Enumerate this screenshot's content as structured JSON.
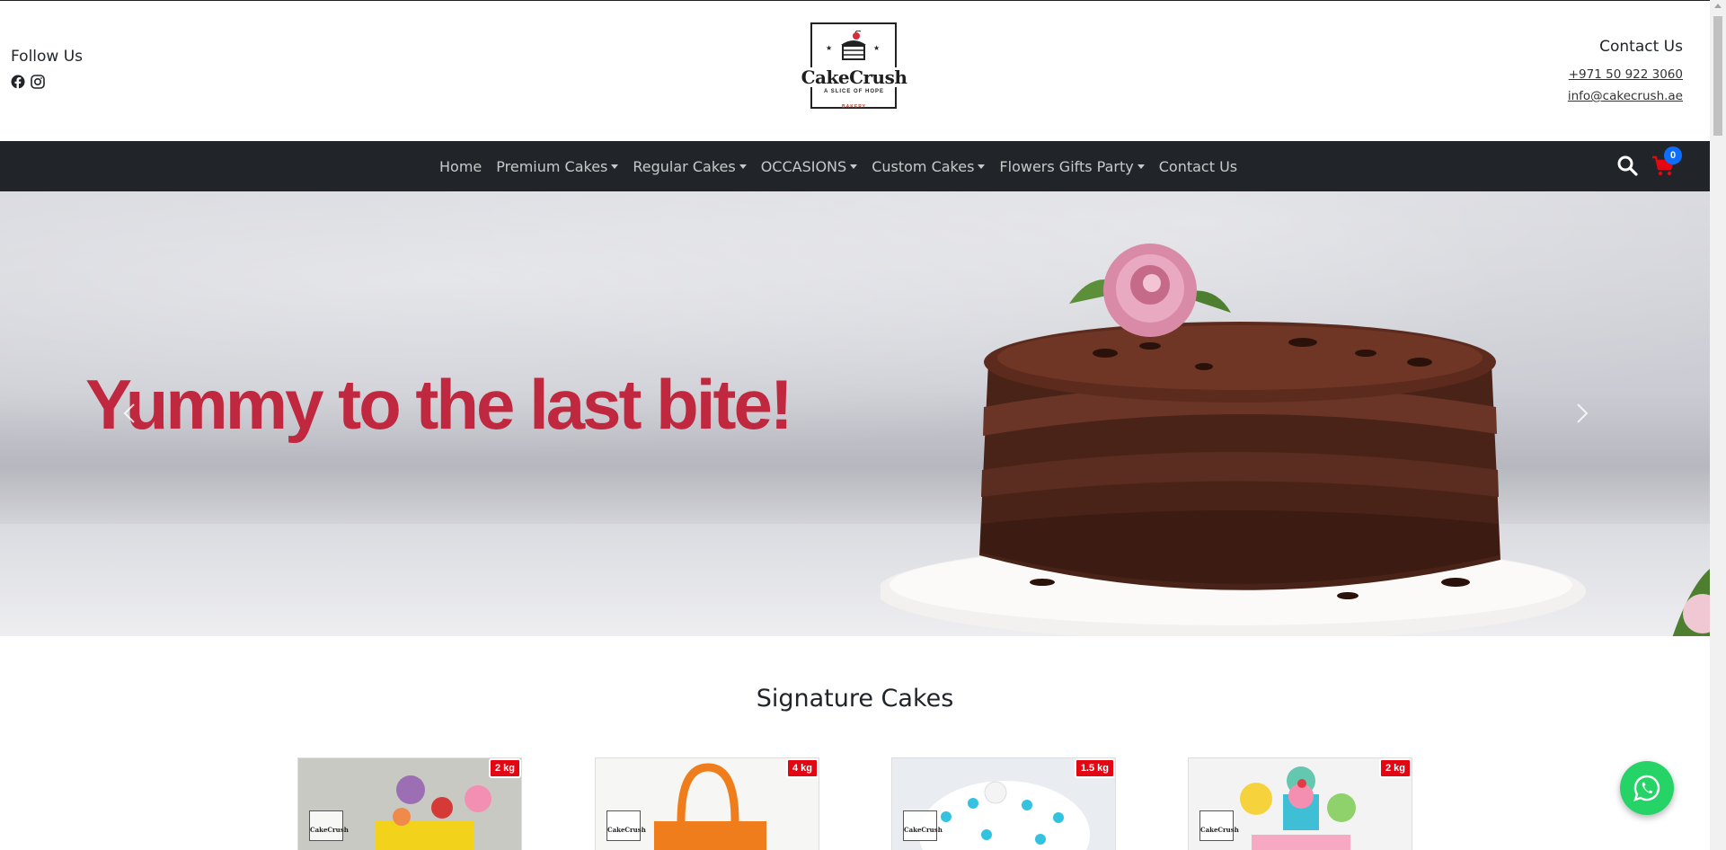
{
  "header": {
    "follow_title": "Follow Us",
    "social": [
      {
        "icon": "facebook-icon"
      },
      {
        "icon": "instagram-icon"
      }
    ],
    "logo": {
      "name": "CakeCrush",
      "tagline": "A SLICE OF HOPE",
      "sub": "BAKERY"
    },
    "contact": {
      "title": "Contact Us",
      "phone": "+971 50 922 3060",
      "email": "info@cakecrush.ae"
    }
  },
  "nav": {
    "items": [
      {
        "label": "Home",
        "dropdown": false
      },
      {
        "label": "Premium Cakes",
        "dropdown": true
      },
      {
        "label": "Regular Cakes",
        "dropdown": true
      },
      {
        "label": "OCCASIONS",
        "dropdown": true
      },
      {
        "label": "Custom Cakes",
        "dropdown": true
      },
      {
        "label": "Flowers Gifts Party",
        "dropdown": true
      },
      {
        "label": "Contact Us",
        "dropdown": false
      }
    ],
    "cart_count": "0"
  },
  "hero": {
    "headline": "Yummy to the last bite!"
  },
  "signature": {
    "title": "Signature Cakes",
    "cards": [
      {
        "weight": "2 kg",
        "logo_text": "CakeCrush"
      },
      {
        "weight": "4 kg",
        "logo_text": "CakeCrush"
      },
      {
        "weight": "1.5 kg",
        "logo_text": "CakeCrush"
      },
      {
        "weight": "2 kg",
        "logo_text": "CakeCrush"
      }
    ]
  },
  "colors": {
    "navbar_bg": "#212529",
    "hero_text": "#c0283f",
    "badge_red": "#e30613",
    "cart_badge": "#0d6efd",
    "whatsapp": "#25d366"
  }
}
